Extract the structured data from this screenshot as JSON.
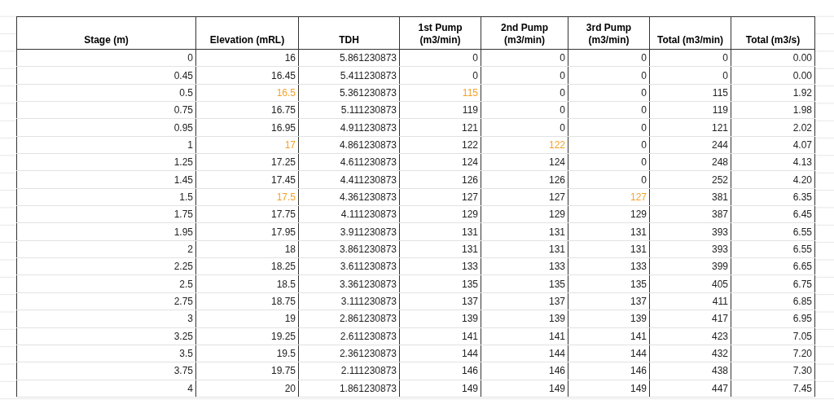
{
  "table": {
    "columns": [
      "Stage (m)",
      "Elevation (mRL)",
      "TDH",
      "1st Pump (m3/min)",
      "2nd Pump (m3/min)",
      "3rd Pump (m3/min)",
      "Total (m3/min)",
      "Total (m3/s)"
    ],
    "rows": [
      {
        "cells": [
          {
            "text": "0",
            "highlighted": false
          },
          {
            "text": "16",
            "highlighted": false
          },
          {
            "text": "5.861230873",
            "highlighted": false
          },
          {
            "text": "0",
            "highlighted": false
          },
          {
            "text": "0",
            "highlighted": false
          },
          {
            "text": "0",
            "highlighted": false
          },
          {
            "text": "0",
            "highlighted": false
          },
          {
            "text": "0.00",
            "highlighted": false
          }
        ]
      },
      {
        "cells": [
          {
            "text": "0.45",
            "highlighted": false
          },
          {
            "text": "16.45",
            "highlighted": false
          },
          {
            "text": "5.411230873",
            "highlighted": false
          },
          {
            "text": "0",
            "highlighted": false
          },
          {
            "text": "0",
            "highlighted": false
          },
          {
            "text": "0",
            "highlighted": false
          },
          {
            "text": "0",
            "highlighted": false
          },
          {
            "text": "0.00",
            "highlighted": false
          }
        ]
      },
      {
        "cells": [
          {
            "text": "0.5",
            "highlighted": false
          },
          {
            "text": "16.5",
            "highlighted": true
          },
          {
            "text": "5.361230873",
            "highlighted": false
          },
          {
            "text": "115",
            "highlighted": true
          },
          {
            "text": "0",
            "highlighted": false
          },
          {
            "text": "0",
            "highlighted": false
          },
          {
            "text": "115",
            "highlighted": false
          },
          {
            "text": "1.92",
            "highlighted": false
          }
        ]
      },
      {
        "cells": [
          {
            "text": "0.75",
            "highlighted": false
          },
          {
            "text": "16.75",
            "highlighted": false
          },
          {
            "text": "5.111230873",
            "highlighted": false
          },
          {
            "text": "119",
            "highlighted": false
          },
          {
            "text": "0",
            "highlighted": false
          },
          {
            "text": "0",
            "highlighted": false
          },
          {
            "text": "119",
            "highlighted": false
          },
          {
            "text": "1.98",
            "highlighted": false
          }
        ]
      },
      {
        "cells": [
          {
            "text": "0.95",
            "highlighted": false
          },
          {
            "text": "16.95",
            "highlighted": false
          },
          {
            "text": "4.911230873",
            "highlighted": false
          },
          {
            "text": "121",
            "highlighted": false
          },
          {
            "text": "0",
            "highlighted": false
          },
          {
            "text": "0",
            "highlighted": false
          },
          {
            "text": "121",
            "highlighted": false
          },
          {
            "text": "2.02",
            "highlighted": false
          }
        ]
      },
      {
        "cells": [
          {
            "text": "1",
            "highlighted": false
          },
          {
            "text": "17",
            "highlighted": true
          },
          {
            "text": "4.861230873",
            "highlighted": false
          },
          {
            "text": "122",
            "highlighted": false
          },
          {
            "text": "122",
            "highlighted": true
          },
          {
            "text": "0",
            "highlighted": false
          },
          {
            "text": "244",
            "highlighted": false
          },
          {
            "text": "4.07",
            "highlighted": false
          }
        ]
      },
      {
        "cells": [
          {
            "text": "1.25",
            "highlighted": false
          },
          {
            "text": "17.25",
            "highlighted": false
          },
          {
            "text": "4.611230873",
            "highlighted": false
          },
          {
            "text": "124",
            "highlighted": false
          },
          {
            "text": "124",
            "highlighted": false
          },
          {
            "text": "0",
            "highlighted": false
          },
          {
            "text": "248",
            "highlighted": false
          },
          {
            "text": "4.13",
            "highlighted": false
          }
        ]
      },
      {
        "cells": [
          {
            "text": "1.45",
            "highlighted": false
          },
          {
            "text": "17.45",
            "highlighted": false
          },
          {
            "text": "4.411230873",
            "highlighted": false
          },
          {
            "text": "126",
            "highlighted": false
          },
          {
            "text": "126",
            "highlighted": false
          },
          {
            "text": "0",
            "highlighted": false
          },
          {
            "text": "252",
            "highlighted": false
          },
          {
            "text": "4.20",
            "highlighted": false
          }
        ]
      },
      {
        "cells": [
          {
            "text": "1.5",
            "highlighted": false
          },
          {
            "text": "17.5",
            "highlighted": true
          },
          {
            "text": "4.361230873",
            "highlighted": false
          },
          {
            "text": "127",
            "highlighted": false
          },
          {
            "text": "127",
            "highlighted": false
          },
          {
            "text": "127",
            "highlighted": true
          },
          {
            "text": "381",
            "highlighted": false
          },
          {
            "text": "6.35",
            "highlighted": false
          }
        ]
      },
      {
        "cells": [
          {
            "text": "1.75",
            "highlighted": false
          },
          {
            "text": "17.75",
            "highlighted": false
          },
          {
            "text": "4.111230873",
            "highlighted": false
          },
          {
            "text": "129",
            "highlighted": false
          },
          {
            "text": "129",
            "highlighted": false
          },
          {
            "text": "129",
            "highlighted": false
          },
          {
            "text": "387",
            "highlighted": false
          },
          {
            "text": "6.45",
            "highlighted": false
          }
        ]
      },
      {
        "cells": [
          {
            "text": "1.95",
            "highlighted": false
          },
          {
            "text": "17.95",
            "highlighted": false
          },
          {
            "text": "3.911230873",
            "highlighted": false
          },
          {
            "text": "131",
            "highlighted": false
          },
          {
            "text": "131",
            "highlighted": false
          },
          {
            "text": "131",
            "highlighted": false
          },
          {
            "text": "393",
            "highlighted": false
          },
          {
            "text": "6.55",
            "highlighted": false
          }
        ]
      },
      {
        "cells": [
          {
            "text": "2",
            "highlighted": false
          },
          {
            "text": "18",
            "highlighted": false
          },
          {
            "text": "3.861230873",
            "highlighted": false
          },
          {
            "text": "131",
            "highlighted": false
          },
          {
            "text": "131",
            "highlighted": false
          },
          {
            "text": "131",
            "highlighted": false
          },
          {
            "text": "393",
            "highlighted": false
          },
          {
            "text": "6.55",
            "highlighted": false
          }
        ]
      },
      {
        "cells": [
          {
            "text": "2.25",
            "highlighted": false
          },
          {
            "text": "18.25",
            "highlighted": false
          },
          {
            "text": "3.611230873",
            "highlighted": false
          },
          {
            "text": "133",
            "highlighted": false
          },
          {
            "text": "133",
            "highlighted": false
          },
          {
            "text": "133",
            "highlighted": false
          },
          {
            "text": "399",
            "highlighted": false
          },
          {
            "text": "6.65",
            "highlighted": false
          }
        ]
      },
      {
        "cells": [
          {
            "text": "2.5",
            "highlighted": false
          },
          {
            "text": "18.5",
            "highlighted": false
          },
          {
            "text": "3.361230873",
            "highlighted": false
          },
          {
            "text": "135",
            "highlighted": false
          },
          {
            "text": "135",
            "highlighted": false
          },
          {
            "text": "135",
            "highlighted": false
          },
          {
            "text": "405",
            "highlighted": false
          },
          {
            "text": "6.75",
            "highlighted": false
          }
        ]
      },
      {
        "cells": [
          {
            "text": "2.75",
            "highlighted": false
          },
          {
            "text": "18.75",
            "highlighted": false
          },
          {
            "text": "3.111230873",
            "highlighted": false
          },
          {
            "text": "137",
            "highlighted": false
          },
          {
            "text": "137",
            "highlighted": false
          },
          {
            "text": "137",
            "highlighted": false
          },
          {
            "text": "411",
            "highlighted": false
          },
          {
            "text": "6.85",
            "highlighted": false
          }
        ]
      },
      {
        "cells": [
          {
            "text": "3",
            "highlighted": false
          },
          {
            "text": "19",
            "highlighted": false
          },
          {
            "text": "2.861230873",
            "highlighted": false
          },
          {
            "text": "139",
            "highlighted": false
          },
          {
            "text": "139",
            "highlighted": false
          },
          {
            "text": "139",
            "highlighted": false
          },
          {
            "text": "417",
            "highlighted": false
          },
          {
            "text": "6.95",
            "highlighted": false
          }
        ]
      },
      {
        "cells": [
          {
            "text": "3.25",
            "highlighted": false
          },
          {
            "text": "19.25",
            "highlighted": false
          },
          {
            "text": "2.611230873",
            "highlighted": false
          },
          {
            "text": "141",
            "highlighted": false
          },
          {
            "text": "141",
            "highlighted": false
          },
          {
            "text": "141",
            "highlighted": false
          },
          {
            "text": "423",
            "highlighted": false
          },
          {
            "text": "7.05",
            "highlighted": false
          }
        ]
      },
      {
        "cells": [
          {
            "text": "3.5",
            "highlighted": false
          },
          {
            "text": "19.5",
            "highlighted": false
          },
          {
            "text": "2.361230873",
            "highlighted": false
          },
          {
            "text": "144",
            "highlighted": false
          },
          {
            "text": "144",
            "highlighted": false
          },
          {
            "text": "144",
            "highlighted": false
          },
          {
            "text": "432",
            "highlighted": false
          },
          {
            "text": "7.20",
            "highlighted": false
          }
        ]
      },
      {
        "cells": [
          {
            "text": "3.75",
            "highlighted": false
          },
          {
            "text": "19.75",
            "highlighted": false
          },
          {
            "text": "2.111230873",
            "highlighted": false
          },
          {
            "text": "146",
            "highlighted": false
          },
          {
            "text": "146",
            "highlighted": false
          },
          {
            "text": "146",
            "highlighted": false
          },
          {
            "text": "438",
            "highlighted": false
          },
          {
            "text": "7.30",
            "highlighted": false
          }
        ]
      },
      {
        "cells": [
          {
            "text": "4",
            "highlighted": false
          },
          {
            "text": "20",
            "highlighted": false
          },
          {
            "text": "1.861230873",
            "highlighted": false
          },
          {
            "text": "149",
            "highlighted": false
          },
          {
            "text": "149",
            "highlighted": false
          },
          {
            "text": "149",
            "highlighted": false
          },
          {
            "text": "447",
            "highlighted": false
          },
          {
            "text": "7.45",
            "highlighted": false
          }
        ]
      }
    ]
  }
}
